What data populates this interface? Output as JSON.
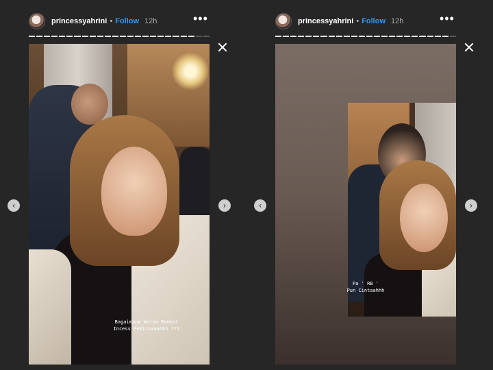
{
  "stories": [
    {
      "username": "princessyahrini",
      "separator": "•",
      "follow_label": "Follow",
      "time": "12h",
      "more_icon": "more-horizontal-icon",
      "progress": {
        "segments": 24,
        "completed": 22
      },
      "caption": "Bagaimana Warna Rambut\nIncess Pemirsaaahhh ???",
      "icons": {
        "close": "close-icon",
        "prev": "chevron-left-icon",
        "next": "chevron-right-icon"
      }
    },
    {
      "username": "princessyahrini",
      "separator": "•",
      "follow_label": "Follow",
      "time": "12h",
      "more_icon": "more-horizontal-icon",
      "progress": {
        "segments": 24,
        "completed": 23
      },
      "caption": "Pa ' RB '\nPun Cintaahhh",
      "icons": {
        "close": "close-icon",
        "prev": "chevron-left-icon",
        "next": "chevron-right-icon"
      }
    }
  ],
  "colors": {
    "background": "#262626",
    "follow": "#3897f0",
    "progress_done": "#e6e6e6",
    "progress_pending": "#5a5a5a"
  }
}
